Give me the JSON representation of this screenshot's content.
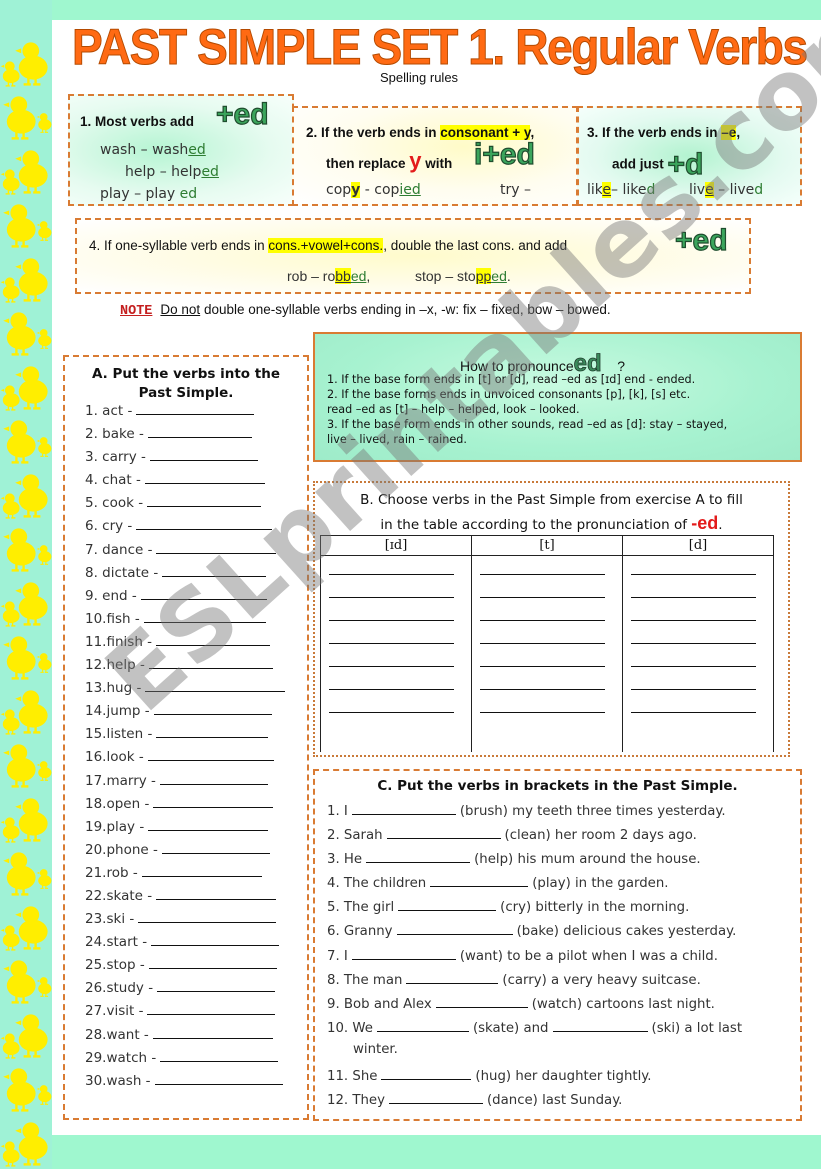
{
  "title": "PAST SIMPLE SET 1. Regular Verbs",
  "subtitle": "Spelling rules",
  "rules": {
    "rule1": {
      "text": "1. Most verbs add",
      "suffix": "+ed",
      "examples": [
        {
          "base": "wash – wash",
          "ending": "ed"
        },
        {
          "base": "help – help",
          "ending": "ed"
        },
        {
          "base": "play – play ",
          "ending": "ed"
        }
      ]
    },
    "rule2": {
      "line1_prefix": "2. If the verb ends in ",
      "line1_highlight": "consonant + y",
      "line1_suffix": ",",
      "line2_prefix": "then replace ",
      "line2_letter": "y",
      "line2_mid": " with",
      "suffix": "i+ed",
      "ex1_base": "cop",
      "ex1_hl": "y",
      "ex1_mid": " - cop",
      "ex1_ending": "ied",
      "ex2": "try –"
    },
    "rule3": {
      "line1_prefix": "3. If  the verb ends in ",
      "line1_highlight": "–e",
      "line1_suffix": ",",
      "line2": "add just",
      "suffix": "+d",
      "ex1_a": "lik",
      "ex1_hl": "e",
      "ex1_b": "– like",
      "ex1_ending": "d",
      "ex2_a": "liv",
      "ex2_hl": "e",
      "ex2_b": " – live",
      "ex2_ending": "d"
    },
    "rule4": {
      "prefix": "4. If one-syllable verb ends in  ",
      "highlight": "cons.+vowel+cons.",
      "suffix": ", double the last cons. and add",
      "ed": "+ed",
      "ex1_a": "rob – ro",
      "ex1_hl": "bb",
      "ex1_ending": "ed",
      "ex1_c": ",",
      "ex2_a": "stop – sto",
      "ex2_hl": "pp",
      "ex2_ending": "ed",
      "ex2_c": "."
    }
  },
  "note": {
    "label": "NOTE",
    "underlined": "Do not",
    "text": " double one-syllable verbs ending in –x, -w: fix – fixed, bow – bowed."
  },
  "pronunciation": {
    "title_prefix": "How to pronounce",
    "title_logo": "ed",
    "title_suffix": "?",
    "items": [
      "1. If the base form ends in [t] or [d], read –ed as [ɪd] end  - ended.",
      "2. If the base forms ends in unvoiced consonants [p], [k], [s] etc.",
      "    read –ed as [t] – help – helped, look – looked.",
      "3. If the base form ends in other sounds, read –ed as [d]: stay – stayed,",
      "    live – lived,  rain – rained."
    ]
  },
  "exercise_a": {
    "title_line1": "A. Put the verbs into the",
    "title_line2": "Past Simple.",
    "verbs": [
      "1.  act -",
      "2.  bake -",
      "3.  carry -",
      "4.  chat -",
      "5.  cook  -",
      "6.  cry -",
      "7.  dance -",
      "8.  dictate -",
      "9.  end -",
      "10.fish -",
      "11.finish -",
      "12.help -",
      "13.hug -",
      "14.jump -",
      "15.listen -",
      "16.look -",
      "17.marry -",
      "18.open -",
      "19.play -",
      "20.phone -",
      "21.rob -",
      "22.skate -",
      "23.ski -",
      "24.start -",
      "25.stop -",
      "26.study -",
      "27.visit -",
      "28.want -",
      "29.watch -",
      "30.wash -"
    ]
  },
  "exercise_b": {
    "title_line1": "B. Choose verbs in the Past Simple from exercise A to fill",
    "title_line2": "in the table according to the pronunciation of ",
    "title_ed": "-ed",
    "title_end": ".",
    "columns": [
      "[ɪd]",
      "[t]",
      "[d]"
    ],
    "rows_per_column": 7
  },
  "exercise_c": {
    "title": "C. Put the verbs in brackets in the Past Simple.",
    "sentences": [
      {
        "pre": "1. I",
        "post": "(brush) my teeth three times yesterday."
      },
      {
        "pre": "2. Sarah",
        "post": "(clean) her room 2 days ago."
      },
      {
        "pre": "3. He",
        "post": "(help) his mum around the house."
      },
      {
        "pre": "4. The children",
        "post": "(play) in the garden."
      },
      {
        "pre": "5. The girl",
        "post": "(cry) bitterly in the morning."
      },
      {
        "pre": "6. Granny",
        "post": "(bake) delicious cakes yesterday."
      },
      {
        "pre": "7. I",
        "post": "(want) to be a pilot when I was a child."
      },
      {
        "pre": "8. The man",
        "post": "(carry) a very heavy suitcase."
      },
      {
        "pre": "9. Bob and Alex",
        "post": "(watch) cartoons last night."
      },
      {
        "pre": "10. We",
        "mid": "(skate) and",
        "post": "(ski) a lot last"
      },
      {
        "cont": "winter."
      },
      {
        "pre": "11. She",
        "post": "(hug) her daughter tightly."
      },
      {
        "pre": "12. They",
        "post": "(dance) last Sunday."
      }
    ]
  },
  "watermark": "ESLprintables.com",
  "colors": {
    "title": "#ff6a13",
    "border": "#d97b33",
    "background": "#9ff7cf",
    "highlight": "#ffff00",
    "ed_green": "#2e7d32",
    "red": "#e31b1b"
  }
}
